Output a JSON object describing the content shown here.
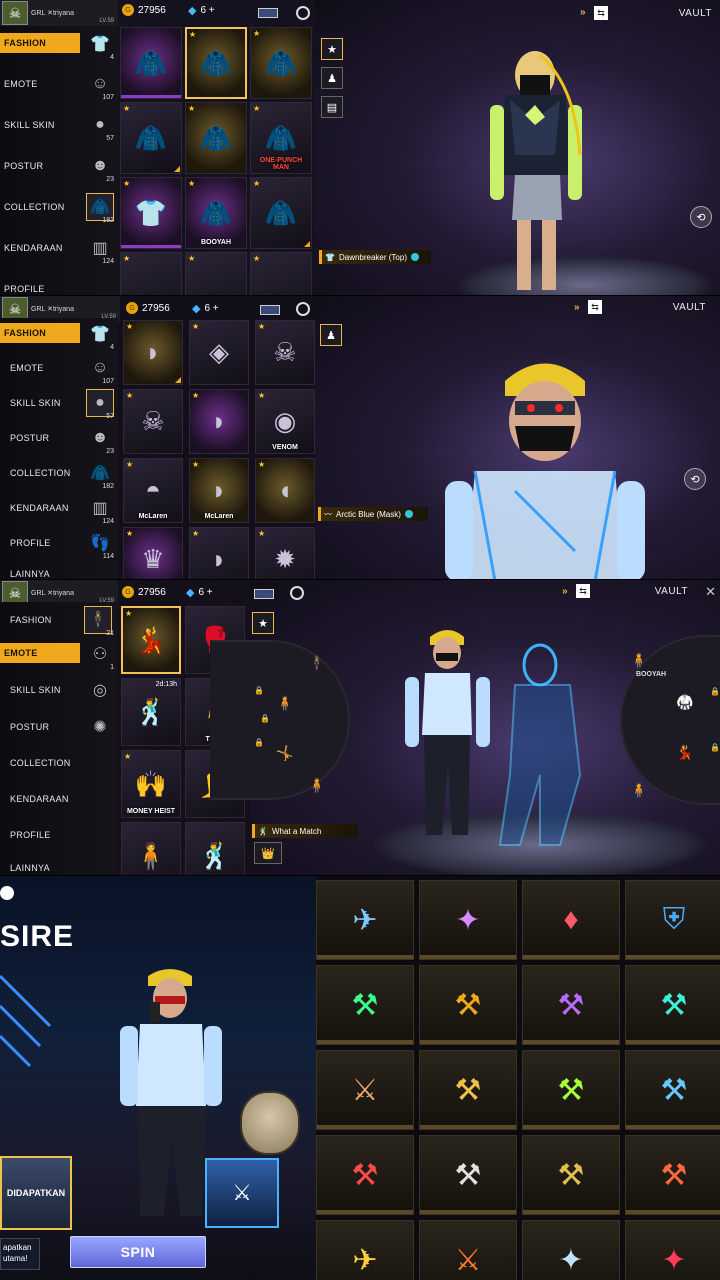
{
  "profile": {
    "tag": "GRL",
    "name": "triyana",
    "level": "LV.59"
  },
  "currency": {
    "coins": "27956",
    "diamonds": "6 +"
  },
  "vault_label": "VAULT",
  "panel1": {
    "categories": [
      {
        "label": "FASHION",
        "count": "4",
        "icon": "fashion-icon"
      },
      {
        "label": "EMOTE",
        "count": "107",
        "icon": "emote-icon"
      },
      {
        "label": "SKILL SKIN",
        "count": "57",
        "icon": "mask-icon"
      },
      {
        "label": "POSTUR",
        "count": "23",
        "icon": "head-icon"
      },
      {
        "label": "COLLECTION",
        "count": "182",
        "icon": "jacket-icon"
      },
      {
        "label": "KENDARAAN",
        "count": "124",
        "icon": "pants-icon"
      },
      {
        "label": "PROFILE",
        "count": "",
        "icon": "profile-icon"
      }
    ],
    "items": [
      "jacket-white",
      "jacket-black-star",
      "jacket-yellow",
      "jacket-red-black",
      "jacket-grey",
      "jacket-teal",
      "shirt-white",
      "jacket-purple-7",
      "jacket-dark-trim"
    ],
    "item_tags": {
      "teal": "ONE-PUNCH MAN",
      "purple": "BOOYAH"
    },
    "selected_item": "Dawnbreaker (Top)"
  },
  "panel2": {
    "categories": [
      {
        "label": "FASHION",
        "count": "4"
      },
      {
        "label": "EMOTE",
        "count": "107"
      },
      {
        "label": "SKILL SKIN",
        "count": "57"
      },
      {
        "label": "POSTUR",
        "count": "23"
      },
      {
        "label": "COLLECTION",
        "count": "182"
      },
      {
        "label": "KENDARAAN",
        "count": "124"
      },
      {
        "label": "PROFILE",
        "count": "114"
      },
      {
        "label": "LAINNYA",
        "count": ""
      }
    ],
    "item_tags": {
      "venom": "VENOM",
      "mclaren1": "McLaren",
      "mclaren2": "McLaren"
    },
    "selected_item": "Arctic Blue (Mask)"
  },
  "panel3": {
    "categories": [
      {
        "label": "FASHION",
        "count": "21"
      },
      {
        "label": "EMOTE",
        "count": "1"
      },
      {
        "label": "SKILL SKIN",
        "count": ""
      },
      {
        "label": "POSTUR",
        "count": ""
      },
      {
        "label": "COLLECTION",
        "count": ""
      },
      {
        "label": "KENDARAAN",
        "count": ""
      },
      {
        "label": "PROFILE",
        "count": ""
      },
      {
        "label": "LAINNYA",
        "count": ""
      }
    ],
    "emote_timer": "2d:13h",
    "emote_tags": {
      "money": "MONEY HEIST",
      "trap": "TRAP",
      "booyah": "BOOYAH"
    },
    "selected_item": "What a Match"
  },
  "panel4": {
    "title_fragment": "SIRE",
    "obtained_label": "DIDAPATKAN",
    "spin_label": "SPIN",
    "reward_label": "apatkan\nutama!",
    "weapons": 20
  }
}
